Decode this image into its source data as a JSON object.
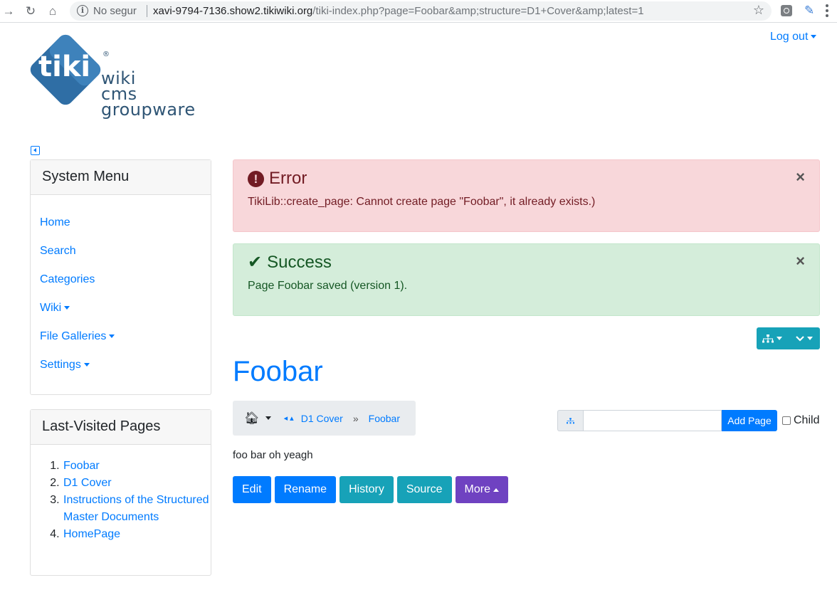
{
  "browser": {
    "not_secure": "No segur",
    "url_host": "xavi-9794-7136.show2.tikiwiki.org",
    "url_path": "/tiki-index.php?page=Foobar&amp;structure=D1+Cover&amp;latest=1"
  },
  "header": {
    "logout_label": "Log out",
    "logo_word": "tiki",
    "logo_reg": "®",
    "logo_lines": [
      "wiki",
      "cms",
      "groupware"
    ]
  },
  "sidebar": {
    "system_menu_title": "System Menu",
    "items": [
      {
        "label": "Home"
      },
      {
        "label": "Search"
      },
      {
        "label": "Categories"
      },
      {
        "label": "Wiki"
      },
      {
        "label": "File Galleries"
      },
      {
        "label": "Settings"
      }
    ],
    "last_visited_title": "Last-Visited Pages",
    "last_visited": [
      "Foobar",
      "D1 Cover",
      "Instructions of the Structured Master Documents",
      "HomePage"
    ]
  },
  "alerts": {
    "error": {
      "title": "Error",
      "message": "TikiLib::create_page: Cannot create page \"Foobar\", it already exists.)"
    },
    "success": {
      "title": "Success",
      "message": "Page Foobar saved (version 1)."
    }
  },
  "page": {
    "title": "Foobar",
    "breadcrumb": [
      "D1 Cover",
      "Foobar"
    ],
    "breadcrumb_separator": "»",
    "add_page_label": "Add Page",
    "add_page_placeholder": "",
    "child_label": "Child",
    "content": "foo bar oh yeagh"
  },
  "actions": {
    "edit": "Edit",
    "rename": "Rename",
    "history": "History",
    "source": "Source",
    "more": "More"
  },
  "colors": {
    "primary": "#007bff",
    "info": "#17a2b8",
    "purple": "#6f42c1",
    "danger_bg": "#f8d7da",
    "success_bg": "#d4edda"
  }
}
